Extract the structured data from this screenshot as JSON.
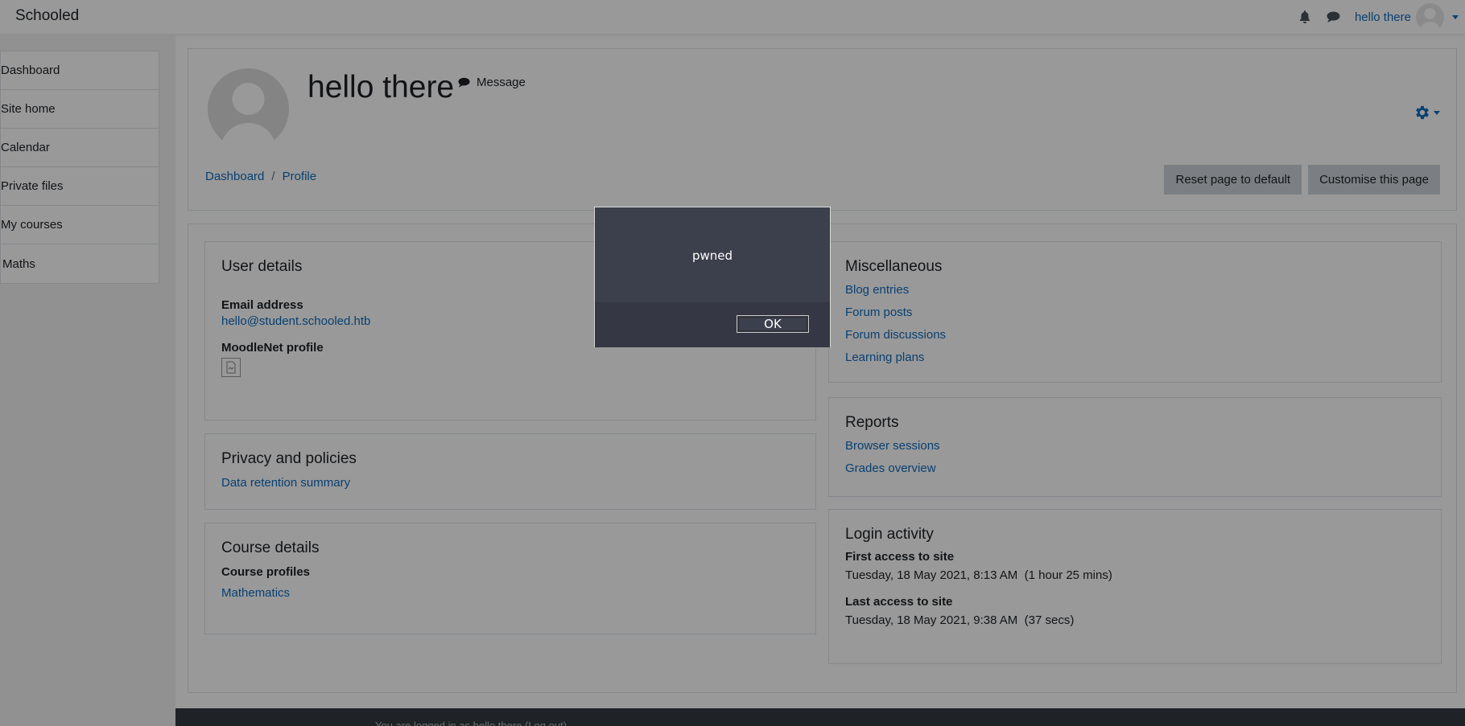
{
  "navbar": {
    "brand": "Schooled",
    "user_name": "hello there"
  },
  "sidebar": {
    "items": [
      {
        "label": "Dashboard"
      },
      {
        "label": "Site home"
      },
      {
        "label": "Calendar"
      },
      {
        "label": "Private files"
      },
      {
        "label": "My courses"
      },
      {
        "label": "Maths"
      }
    ]
  },
  "header": {
    "name": "hello there",
    "message_label": "Message",
    "breadcrumb": [
      "Dashboard",
      "Profile"
    ],
    "reset_button": "Reset page to default",
    "customise_button": "Customise this page"
  },
  "user_details": {
    "title": "User details",
    "email_label": "Email address",
    "email_value": "hello@student.schooled.htb",
    "moodlenet_label": "MoodleNet profile"
  },
  "privacy": {
    "title": "Privacy and policies",
    "link": "Data retention summary"
  },
  "course_details": {
    "title": "Course details",
    "profiles_label": "Course profiles",
    "course": "Mathematics"
  },
  "misc": {
    "title": "Miscellaneous",
    "links": [
      "Blog entries",
      "Forum posts",
      "Forum discussions",
      "Learning plans"
    ]
  },
  "reports": {
    "title": "Reports",
    "links": [
      "Browser sessions",
      "Grades overview"
    ]
  },
  "login_activity": {
    "title": "Login activity",
    "first_label": "First access to site",
    "first_value": "Tuesday, 18 May 2021, 8:13 AM  (1 hour 25 mins)",
    "last_label": "Last access to site",
    "last_value": "Tuesday, 18 May 2021, 9:38 AM  (37 secs)"
  },
  "footer": {
    "text": "You are logged in as hello there (Log out)"
  },
  "dialog": {
    "message": "pwned",
    "ok_label": "OK"
  }
}
